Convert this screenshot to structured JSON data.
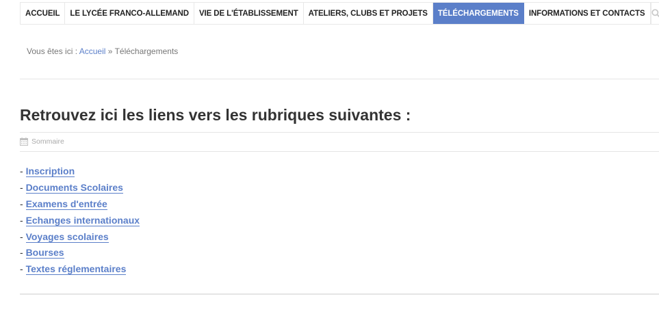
{
  "nav": {
    "items": [
      {
        "label": "ACCUEIL",
        "active": false
      },
      {
        "label": "LE LYCÉE FRANCO-ALLEMAND",
        "active": false
      },
      {
        "label": "VIE DE L'ÉTABLISSEMENT",
        "active": false
      },
      {
        "label": "ATELIERS, CLUBS ET PROJETS",
        "active": false
      },
      {
        "label": "TÉLÉCHARGEMENTS",
        "active": true
      },
      {
        "label": "INFORMATIONS ET CONTACTS",
        "active": false
      }
    ],
    "search_icon": "search-icon",
    "active_color": "#5b7fc9"
  },
  "breadcrumb": {
    "prefix": "Vous êtes ici :",
    "home": "Accueil",
    "separator": "»",
    "current": "Téléchargements"
  },
  "page": {
    "title": "Retrouvez ici les liens vers les rubriques suivantes :",
    "meta_icon": "calendar-icon",
    "meta_label": "Sommaire"
  },
  "links": {
    "bullet": "-",
    "items": [
      "Inscription",
      "Documents Scolaires",
      "Examens d'entrée",
      "Echanges internationaux",
      "Voyages scolaires",
      "Bourses",
      "Textes réglementaires"
    ]
  }
}
